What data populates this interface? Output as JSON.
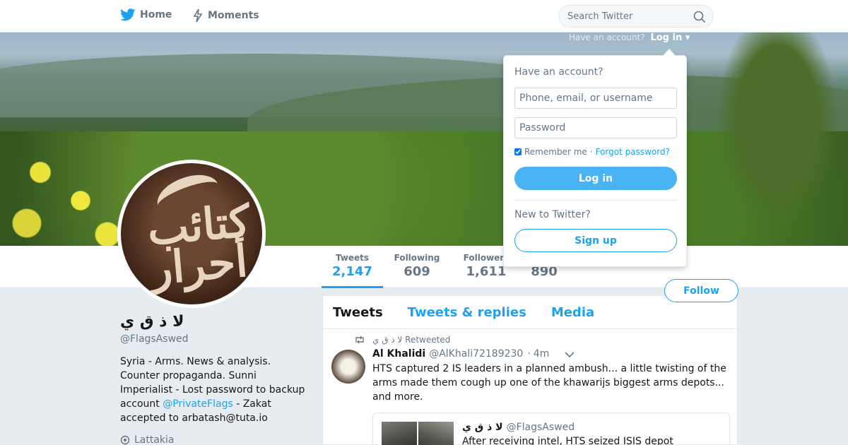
{
  "nav": {
    "home_label": "Home",
    "moments_label": "Moments",
    "search_placeholder": "Search Twitter",
    "have_account_text": "Have an account?",
    "login_link": "Log in"
  },
  "profile": {
    "name": "لا ذ ق ي",
    "handle": "@FlagsAswed",
    "bio_text": "Syria - Arms. News & analysis. Counter propaganda. Sunni Imperialist - Lost password to backup account ",
    "bio_link": "@PrivateFlags",
    "bio_tail": " - Zakat accepted to arbatash@tuta.io",
    "location": "Lattakia",
    "follow_label": "Follow"
  },
  "stats": {
    "tweets_label": "Tweets",
    "tweets_value": "2,147",
    "following_label": "Following",
    "following_value": "609",
    "followers_label": "Followers",
    "followers_value": "1,611",
    "likes_value": "890"
  },
  "timeline": {
    "tabs": [
      "Tweets",
      "Tweets & replies",
      "Media"
    ],
    "retweet_context": "لا ذ ق ي Retweeted",
    "tweet": {
      "author": "Al Khalidi",
      "screen_name": "@AlKhali72189230",
      "dot": "·",
      "time": "4m",
      "text": "HTS captured 2 IS leaders in a planned ambush... a little twisting of the arms made them cough up one of the khawarijs biggest arms depots... and more."
    },
    "quote": {
      "author": "لا ذ ق ي",
      "screen_name": "@FlagsAswed",
      "text": "After receiving intel, HTS seized ISIS depot"
    }
  },
  "login_dropdown": {
    "title": "Have an account?",
    "username_placeholder": "Phone, email, or username",
    "password_placeholder": "Password",
    "remember_label": "Remember me",
    "separator": "·",
    "forgot_label": "Forgot password?",
    "login_button": "Log in",
    "new_title": "New to Twitter?",
    "signup_button": "Sign up"
  },
  "colors": {
    "accent": "#1da1f2",
    "background": "#e6ecf0"
  }
}
